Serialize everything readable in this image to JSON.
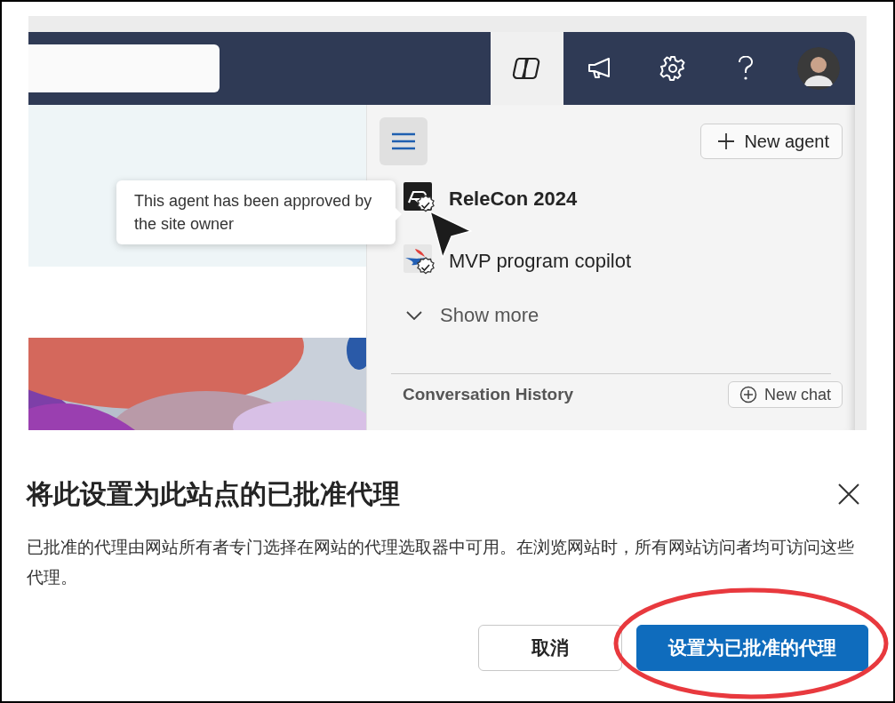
{
  "nav": {
    "tabs": [
      {
        "kind": "copilot",
        "selected": true
      },
      {
        "kind": "announcements",
        "selected": false
      },
      {
        "kind": "settings",
        "selected": false
      },
      {
        "kind": "help",
        "selected": false
      },
      {
        "kind": "profile",
        "selected": false
      }
    ]
  },
  "panel": {
    "new_agent_button": "New agent",
    "agents": [
      {
        "name": "ReleCon 2024",
        "kind": "relecon",
        "selected": true,
        "approved": true
      },
      {
        "name": "MVP program copilot",
        "kind": "mvp",
        "selected": false,
        "approved": true
      }
    ],
    "show_more": "Show more",
    "conversation_history": "Conversation History",
    "new_chat_button": "New chat"
  },
  "tooltip": {
    "text": "This agent has been approved by the site owner"
  },
  "dialog": {
    "title": "将此设置为此站点的已批准代理",
    "body": "已批准的代理由网站所有者专门选择在网站的代理选取器中可用。在浏览网站时，所有网站访问者均可访问这些代理。",
    "buttons": [
      {
        "label": "取消",
        "kind": "secondary",
        "highlighted": false
      },
      {
        "label": "设置为已批准的代理",
        "kind": "primary",
        "highlighted": true
      }
    ]
  }
}
